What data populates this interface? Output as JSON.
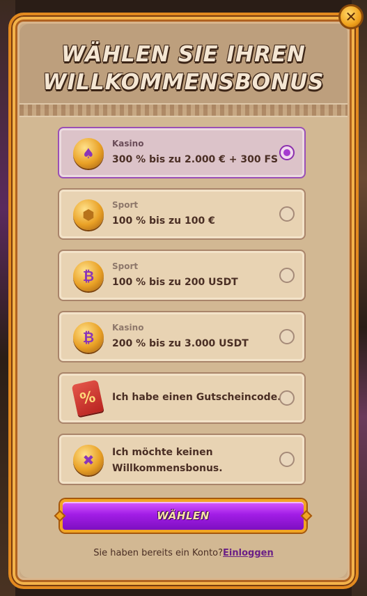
{
  "title_line1": "WÄHLEN SIE IHREN",
  "title_line2": "WILLKOMMENSBONUS",
  "close_label": "✕",
  "options": [
    {
      "category": "Kasino",
      "text": "300 % bis zu 2.000 € + 300 FS",
      "icon": "casino-chip-spade-icon",
      "selected": true
    },
    {
      "category": "Sport",
      "text": "100 % bis zu 100 €",
      "icon": "football-icon",
      "selected": false
    },
    {
      "category": "Sport",
      "text": "100 % bis zu 200 USDT",
      "icon": "bitcoin-coin-icon",
      "selected": false
    },
    {
      "category": "Kasino",
      "text": "200 % bis zu 3.000 USDT",
      "icon": "bitcoin-coin-icon",
      "selected": false
    },
    {
      "category": "",
      "text": "Ich habe einen Gutscheincode.",
      "icon": "coupon-tag-icon",
      "selected": false
    },
    {
      "category": "",
      "text_line1": "Ich möchte keinen",
      "text_line2": "Willkommensbonus.",
      "icon": "no-bonus-x-icon",
      "selected": false
    }
  ],
  "choose_button": "WÄHLEN",
  "footer": {
    "question": "Sie haben bereits ein Konto?",
    "login_link": "Einloggen"
  },
  "colors": {
    "accent_purple": "#a21de6",
    "frame_orange": "#e38a1f",
    "panel_beige": "#d2b893"
  }
}
